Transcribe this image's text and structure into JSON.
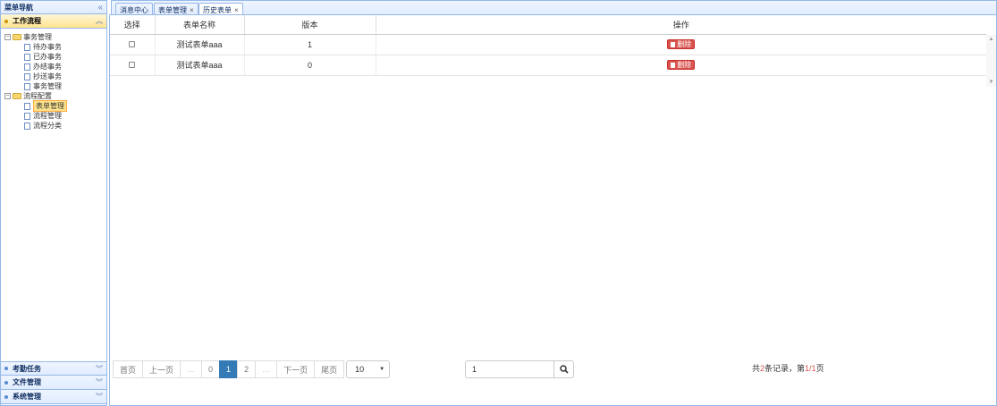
{
  "sidebar": {
    "title": "菜单导航",
    "accordion_top": "工作流程",
    "tree": {
      "group1": "事务管理",
      "group1_items": [
        "待办事务",
        "已办事务",
        "办结事务",
        "抄送事务",
        "事务管理"
      ],
      "group2": "流程配置",
      "group2_items": [
        "表单管理",
        "流程管理",
        "流程分类"
      ]
    },
    "accordion_bottom": [
      "考勤任务",
      "文件管理",
      "系统管理"
    ]
  },
  "tabs": [
    {
      "label": "消息中心",
      "closable": false
    },
    {
      "label": "表单管理",
      "closable": true
    },
    {
      "label": "历史表单",
      "closable": true
    }
  ],
  "table": {
    "headers": [
      "选择",
      "表单名称",
      "版本",
      "操作"
    ],
    "rows": [
      {
        "name": "测试表单aaa",
        "version": "1",
        "action": "删除"
      },
      {
        "name": "测试表单aaa",
        "version": "0",
        "action": "删除"
      }
    ]
  },
  "pagination": {
    "first": "首页",
    "prev": "上一页",
    "ellipsis": "…",
    "pages": [
      "0",
      "1",
      "2"
    ],
    "current": "1",
    "next": "下一页",
    "last": "尾页",
    "page_size": "10"
  },
  "search": {
    "value": "1"
  },
  "summary": {
    "prefix": "共",
    "total": "2",
    "mid": "条记录，第",
    "page": "1/1",
    "suffix": "页"
  },
  "colors": {
    "accent": "#337ab7",
    "danger": "#d9534f",
    "border": "#95b8e7",
    "selected": "#ffe48d"
  },
  "icons": {
    "collapse": "double-chevron-left-icon",
    "search": "search-icon",
    "delete": "trash-icon"
  }
}
